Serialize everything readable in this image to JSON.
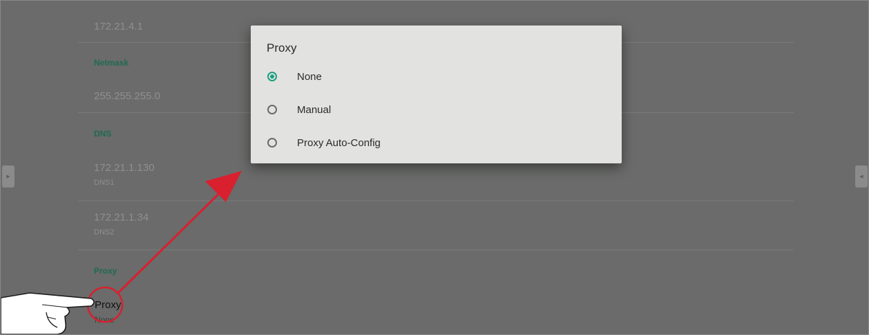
{
  "settings": {
    "gateway_value": "172.21.4.1",
    "netmask_header": "Netmask",
    "netmask_value": "255.255.255.0",
    "dns_header": "DNS",
    "dns1_value": "172.21.1.130",
    "dns1_label": "DNS1",
    "dns2_value": "172.21.1.34",
    "dns2_label": "DNS2",
    "proxy_header": "Proxy",
    "proxy_label": "Proxy",
    "proxy_value": "None"
  },
  "dialog": {
    "title": "Proxy",
    "options": [
      {
        "label": "None",
        "selected": true
      },
      {
        "label": "Manual",
        "selected": false
      },
      {
        "label": "Proxy Auto-Config",
        "selected": false
      }
    ]
  },
  "colors": {
    "accent": "#1c9d80",
    "header_text": "#1f6b52",
    "callout": "#d8202f"
  },
  "icons": {
    "left_tab": "chevron-right-icon",
    "right_tab": "chevron-left-icon",
    "pointer": "pointing-hand-icon"
  }
}
